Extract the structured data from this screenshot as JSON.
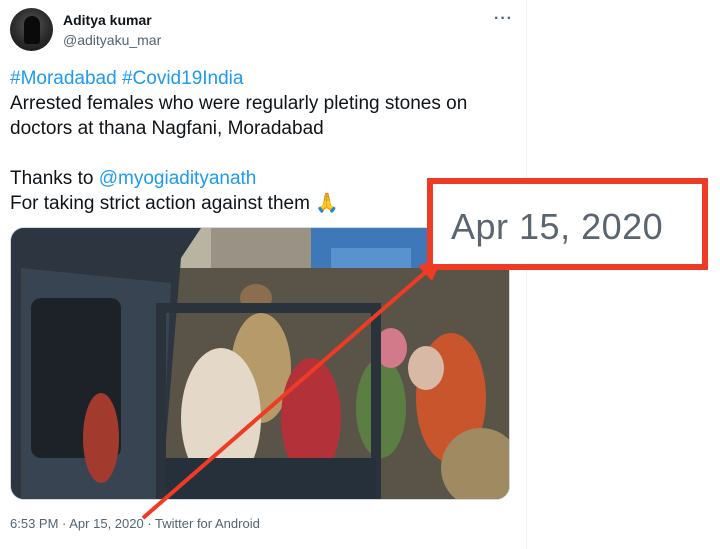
{
  "author": {
    "display_name": "Aditya kumar",
    "handle": "@adityaku_mar"
  },
  "menu": {
    "more_icon": "more-horizontal-icon"
  },
  "tweet": {
    "hashtag_moradabad": "#Moradabad",
    "hashtag_covid": "#Covid19India",
    "line2": "Arrested females who were regularly pleting stones on",
    "line3": "doctors at thana Nagfani, Moradabad",
    "thanks_prefix": "Thanks to ",
    "mention": "@myogiadityanath",
    "line5": "For taking strict action against them",
    "emoji": "🙏"
  },
  "meta": {
    "time": "6:53 PM",
    "separator": " · ",
    "date": "Apr 15, 2020",
    "source": "Twitter for Android"
  },
  "annotation": {
    "zoom_date": "Apr 15, 2020",
    "highlight_color": "#ef3b24"
  },
  "colors": {
    "link": "#1d9bf0",
    "text": "#0f1419",
    "muted": "#536471"
  }
}
